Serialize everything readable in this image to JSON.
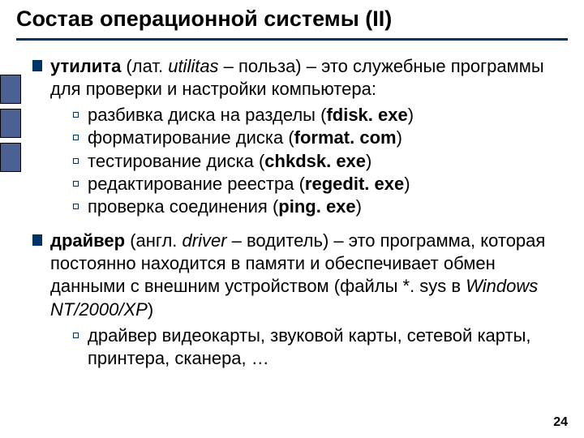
{
  "title": "Состав операционной системы (II)",
  "main": [
    {
      "lead_bold": "утилита",
      "lead_rest_a": " (лат. ",
      "lead_italic": "utilitas",
      "lead_rest_b": " – польза) – это служебные программы для проверки и настройки компьютера:",
      "subs": [
        {
          "t1": "разбивка диска на разделы (",
          "b": "fdisk. exe",
          "t2": ")"
        },
        {
          "t1": "форматирование диска (",
          "b": "format. com",
          "t2": ")"
        },
        {
          "t1": "тестирование диска (",
          "b": "chkdsk. exe",
          "t2": ")"
        },
        {
          "t1": "редактирование реестра (",
          "b": "regedit. exe",
          "t2": ")"
        },
        {
          "t1": "проверка соединения (",
          "b": "ping. exe",
          "t2": ")"
        }
      ]
    },
    {
      "lead_bold": "драйвер",
      "lead_rest_a": " (англ. ",
      "lead_italic": "driver",
      "lead_rest_b": " – водитель) – это программа, которая постоянно находится в памяти и обеспечивает обмен данными с внешним устройством (файлы *. sys в ",
      "lead_italic2": "Windows NT/2000/XP",
      "lead_rest_c": ")",
      "subs": [
        {
          "t1": "драйвер видеокарты, звуковой карты, сетевой карты, принтера, сканера, …",
          "b": "",
          "t2": ""
        }
      ]
    }
  ],
  "page": "24"
}
